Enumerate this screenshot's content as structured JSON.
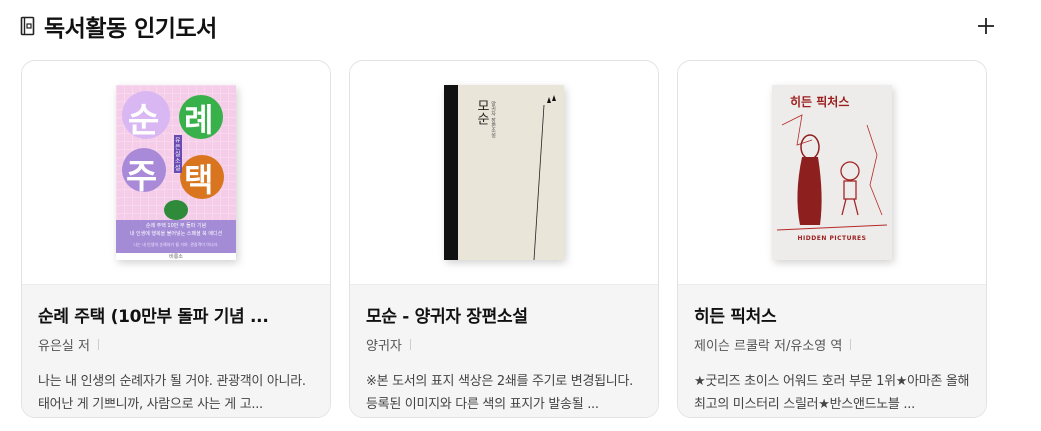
{
  "section": {
    "title": "독서활동 인기도서",
    "icon": "book-icon",
    "more_icon": "plus-icon"
  },
  "books": [
    {
      "title": "순례 주택 (10만부 돌파 기념 ...",
      "author": "유은실 저",
      "description": "나는 내 인생의 순례자가 될 거야. 관광객이 아니라. 태어난 게 기쁘니까, 사람으로 사는 게 고...",
      "cover": {
        "big_letters": [
          "순",
          "례",
          "주",
          "택"
        ],
        "side_label": "유은실 소설",
        "tagline": "순례 주택 10만 부 돌파 기념",
        "tagline2": "내 인생에 행복을 불어넣는 스페셜 북 에디션",
        "small_note": "나는 내 인생의 순례자가 될 거야. 관광객이 아니라.",
        "publisher": "비룡소"
      }
    },
    {
      "title": "모순 - 양귀자 장편소설",
      "author": "양귀자",
      "description": "※본 도서의 표지 색상은 2쇄를 주기로 변경됩니다. 등록된 이미지와 다른 색의 표지가 발송될 ...",
      "cover": {
        "vertical_title": "모순",
        "vertical_sub": "양귀자 장편소설"
      }
    },
    {
      "title": "히든 픽처스",
      "author": "제이슨 르쿨락 저/유소영 역",
      "description": "★굿리즈 초이스 어워드 호러 부문 1위★아마존 올해 최고의 미스터리 스릴러★반스앤드노블 ...",
      "cover": {
        "top_title": "히든 픽처스",
        "bottom_title": "HIDDEN PICTURES"
      }
    }
  ]
}
